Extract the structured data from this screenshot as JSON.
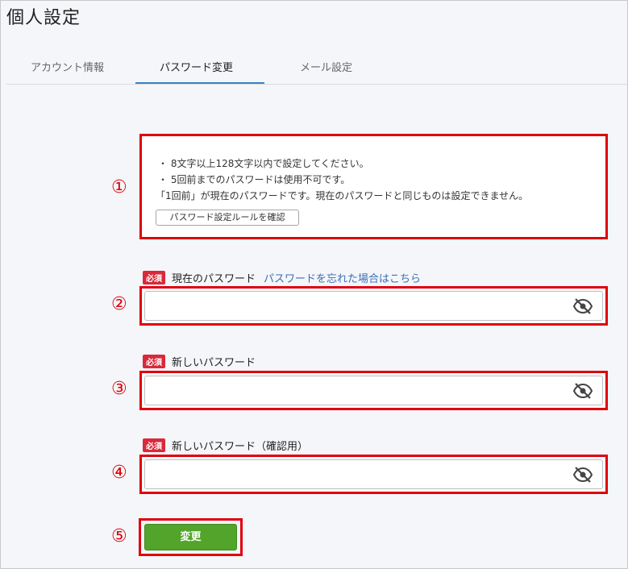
{
  "page": {
    "title": "個人設定"
  },
  "tabs": [
    {
      "label": "アカウント情報",
      "active": false
    },
    {
      "label": "パスワード変更",
      "active": true
    },
    {
      "label": "メール設定",
      "active": false
    }
  ],
  "callouts": [
    "①",
    "②",
    "③",
    "④",
    "⑤"
  ],
  "rules": {
    "lines": [
      "・ 8文字以上128文字以内で設定してください。",
      "・ 5回前までのパスワードは使用不可です。",
      "「1回前」が現在のパスワードです。現在のパスワードと同じものは設定できません。"
    ],
    "confirm_button": "パスワード設定ルールを確認"
  },
  "form": {
    "required_badge": "必須",
    "current_password_label": "現在のパスワード",
    "forgot_link": "パスワードを忘れた場合はこちら",
    "new_password_label": "新しいパスワード",
    "confirm_password_label": "新しいパスワード（確認用）",
    "submit_label": "変更"
  },
  "colors": {
    "annotation_red": "#e0000b",
    "submit_green": "#52a52a",
    "tab_accent": "#3b82c4",
    "required_red": "#d9293a"
  },
  "icons": {
    "visibility_toggle": "eye-off-icon"
  }
}
